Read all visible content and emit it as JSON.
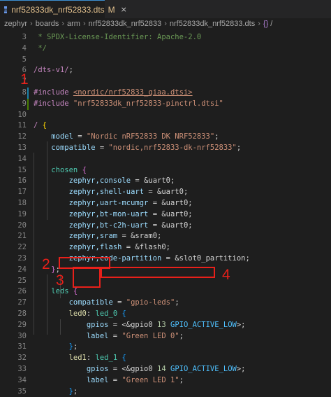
{
  "tab": {
    "name": "nrf52833dk_nrf52833.dts",
    "modified": "M",
    "close": "×",
    "icon": "devicetree-file-icon"
  },
  "breadcrumbs": [
    "zephyr",
    "boards",
    "arm",
    "nrf52833dk_nrf52833",
    "nrf52833dk_nrf52833.dts",
    "/"
  ],
  "lines": [
    {
      "n": "3",
      "t": [
        [
          "comment",
          " * SPDX-License-Identifier: Apache-2.0"
        ]
      ]
    },
    {
      "n": "4",
      "t": [
        [
          "comment",
          " */"
        ]
      ]
    },
    {
      "n": "5",
      "t": []
    },
    {
      "n": "6",
      "t": [
        [
          "keyword",
          "/dts-v1/"
        ],
        [
          "punc",
          ";"
        ]
      ]
    },
    {
      "n": "7",
      "t": []
    },
    {
      "n": "8",
      "t": [
        [
          "keyword",
          "#include "
        ],
        [
          "string-u",
          "<nordic/nrf52833_qiaa.dtsi>"
        ]
      ]
    },
    {
      "n": "9",
      "t": [
        [
          "keyword",
          "#include "
        ],
        [
          "string",
          "\"nrf52833dk_nrf52833-pinctrl.dtsi\""
        ]
      ]
    },
    {
      "n": "10",
      "t": []
    },
    {
      "n": "11",
      "t": [
        [
          "keyword",
          "/ "
        ],
        [
          "brace",
          "{"
        ]
      ]
    },
    {
      "n": "12",
      "t": [
        [
          "punc",
          "    "
        ],
        [
          "prop",
          "model"
        ],
        [
          "punc",
          " = "
        ],
        [
          "string",
          "\"Nordic nRF52833 DK NRF52833\""
        ],
        [
          "punc",
          ";"
        ]
      ]
    },
    {
      "n": "13",
      "t": [
        [
          "punc",
          "    "
        ],
        [
          "prop",
          "compatible"
        ],
        [
          "punc",
          " = "
        ],
        [
          "string",
          "\"nordic,nrf52833-dk-nrf52833\""
        ],
        [
          "punc",
          ";"
        ]
      ]
    },
    {
      "n": "14",
      "t": []
    },
    {
      "n": "15",
      "t": [
        [
          "punc",
          "    "
        ],
        [
          "node",
          "chosen"
        ],
        [
          "punc",
          " "
        ],
        [
          "brace2",
          "{"
        ]
      ]
    },
    {
      "n": "16",
      "t": [
        [
          "punc",
          "        "
        ],
        [
          "prop",
          "zephyr,console"
        ],
        [
          "punc",
          " = "
        ],
        [
          "ref",
          "&uart0"
        ],
        [
          "punc",
          ";"
        ]
      ]
    },
    {
      "n": "17",
      "t": [
        [
          "punc",
          "        "
        ],
        [
          "prop",
          "zephyr,shell-uart"
        ],
        [
          "punc",
          " = "
        ],
        [
          "ref",
          "&uart0"
        ],
        [
          "punc",
          ";"
        ]
      ]
    },
    {
      "n": "18",
      "t": [
        [
          "punc",
          "        "
        ],
        [
          "prop",
          "zephyr,uart-mcumgr"
        ],
        [
          "punc",
          " = "
        ],
        [
          "ref",
          "&uart0"
        ],
        [
          "punc",
          ";"
        ]
      ]
    },
    {
      "n": "19",
      "t": [
        [
          "punc",
          "        "
        ],
        [
          "prop",
          "zephyr,bt-mon-uart"
        ],
        [
          "punc",
          " = "
        ],
        [
          "ref",
          "&uart0"
        ],
        [
          "punc",
          ";"
        ]
      ]
    },
    {
      "n": "20",
      "t": [
        [
          "punc",
          "        "
        ],
        [
          "prop",
          "zephyr,bt-c2h-uart"
        ],
        [
          "punc",
          " = "
        ],
        [
          "ref",
          "&uart0"
        ],
        [
          "punc",
          ";"
        ]
      ]
    },
    {
      "n": "21",
      "t": [
        [
          "punc",
          "        "
        ],
        [
          "prop",
          "zephyr,sram"
        ],
        [
          "punc",
          " = "
        ],
        [
          "ref",
          "&sram0"
        ],
        [
          "punc",
          ";"
        ]
      ]
    },
    {
      "n": "22",
      "t": [
        [
          "punc",
          "        "
        ],
        [
          "prop",
          "zephyr,flash"
        ],
        [
          "punc",
          " = "
        ],
        [
          "ref",
          "&flash0"
        ],
        [
          "punc",
          ";"
        ]
      ]
    },
    {
      "n": "23",
      "t": [
        [
          "punc",
          "        "
        ],
        [
          "prop",
          "zephyr,code-partition"
        ],
        [
          "punc",
          " = "
        ],
        [
          "ref",
          "&slot0_partition"
        ],
        [
          "punc",
          ";"
        ]
      ]
    },
    {
      "n": "24",
      "t": [
        [
          "punc",
          "    "
        ],
        [
          "brace2",
          "}"
        ],
        [
          "punc",
          ";"
        ]
      ]
    },
    {
      "n": "25",
      "t": []
    },
    {
      "n": "26",
      "t": [
        [
          "punc",
          "    "
        ],
        [
          "node",
          "leds"
        ],
        [
          "punc",
          " "
        ],
        [
          "brace2",
          "{"
        ]
      ]
    },
    {
      "n": "27",
      "t": [
        [
          "punc",
          "        "
        ],
        [
          "prop",
          "compatible"
        ],
        [
          "punc",
          " = "
        ],
        [
          "string",
          "\"gpio-leds\""
        ],
        [
          "punc",
          ";"
        ]
      ]
    },
    {
      "n": "28",
      "t": [
        [
          "punc",
          "        "
        ],
        [
          "label",
          "led0"
        ],
        [
          "punc",
          ": "
        ],
        [
          "node",
          "led_0"
        ],
        [
          "punc",
          " "
        ],
        [
          "brace3",
          "{"
        ]
      ]
    },
    {
      "n": "29",
      "t": [
        [
          "punc",
          "            "
        ],
        [
          "prop",
          "gpios"
        ],
        [
          "punc",
          " = <"
        ],
        [
          "ref",
          "&gpio0"
        ],
        [
          "punc",
          " "
        ],
        [
          "number",
          "13"
        ],
        [
          "punc",
          " "
        ],
        [
          "macro",
          "GPIO_ACTIVE_LOW"
        ],
        [
          "punc",
          ">;"
        ]
      ]
    },
    {
      "n": "30",
      "t": [
        [
          "punc",
          "            "
        ],
        [
          "prop",
          "label"
        ],
        [
          "punc",
          " = "
        ],
        [
          "string",
          "\"Green LED 0\""
        ],
        [
          "punc",
          ";"
        ]
      ]
    },
    {
      "n": "31",
      "t": [
        [
          "punc",
          "        "
        ],
        [
          "brace3",
          "}"
        ],
        [
          "punc",
          ";"
        ]
      ]
    },
    {
      "n": "32",
      "t": [
        [
          "punc",
          "        "
        ],
        [
          "label",
          "led1"
        ],
        [
          "punc",
          ": "
        ],
        [
          "node",
          "led_1"
        ],
        [
          "punc",
          " "
        ],
        [
          "brace3",
          "{"
        ]
      ]
    },
    {
      "n": "33",
      "t": [
        [
          "punc",
          "            "
        ],
        [
          "prop",
          "gpios"
        ],
        [
          "punc",
          " = <"
        ],
        [
          "ref",
          "&gpio0"
        ],
        [
          "punc",
          " "
        ],
        [
          "number",
          "14"
        ],
        [
          "punc",
          " "
        ],
        [
          "macro",
          "GPIO_ACTIVE_LOW"
        ],
        [
          "punc",
          ">;"
        ]
      ]
    },
    {
      "n": "34",
      "t": [
        [
          "punc",
          "            "
        ],
        [
          "prop",
          "label"
        ],
        [
          "punc",
          " = "
        ],
        [
          "string",
          "\"Green LED 1\""
        ],
        [
          "punc",
          ";"
        ]
      ]
    },
    {
      "n": "35",
      "t": [
        [
          "punc",
          "        "
        ],
        [
          "brace3",
          "}"
        ],
        [
          "punc",
          ";"
        ]
      ]
    }
  ],
  "annotations": {
    "n1": "1",
    "n2": "2",
    "n3": "3",
    "n4": "4"
  },
  "colors": {
    "annotation": "#e8201a",
    "background": "#1e1e1e"
  }
}
